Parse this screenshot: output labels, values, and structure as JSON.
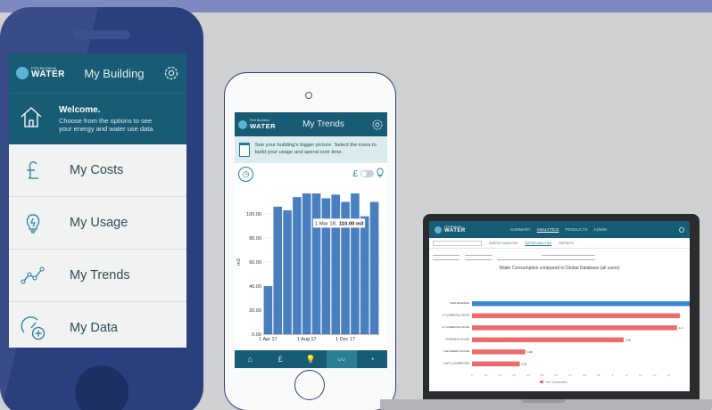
{
  "phone_left": {
    "brand_small": "First Business",
    "brand_big": "WATER",
    "title": "My Building",
    "welcome_title": "Welcome.",
    "welcome_text": "Choose from the options to see your energy and water use data.",
    "menu": [
      {
        "label": "My Costs",
        "icon": "pound-icon"
      },
      {
        "label": "My Usage",
        "icon": "lightbulb-icon"
      },
      {
        "label": "My Trends",
        "icon": "trend-line-icon"
      },
      {
        "label": "My Data",
        "icon": "data-gauge-icon"
      }
    ]
  },
  "phone_middle": {
    "brand_small": "First Business",
    "brand_big": "WATER",
    "title": "My Trends",
    "info_text": "See your building's bigger picture. Select the icons to build your usage and spend over time.",
    "currency_symbol": "£",
    "nav": [
      {
        "icon": "home-icon",
        "glyph": "⌂"
      },
      {
        "icon": "pound-icon",
        "glyph": "£"
      },
      {
        "icon": "lightbulb-icon",
        "glyph": "💡"
      },
      {
        "icon": "trend-line-icon",
        "glyph": "〰"
      },
      {
        "icon": "data-gauge-icon",
        "glyph": "◔"
      }
    ]
  },
  "chart_data": {
    "type": "bar",
    "ylabel": "m3",
    "ylim": [
      0,
      120
    ],
    "yticks": [
      "0.00",
      "20.00",
      "40.00",
      "60.00",
      "80.00",
      "100.00"
    ],
    "xticks": [
      "1 Apr 17",
      "1 Aug 17",
      "1 Dec 17"
    ],
    "values": [
      40,
      106,
      103,
      114,
      117,
      117,
      113,
      116,
      110,
      117,
      98,
      110
    ],
    "bar_color": "#4a7fbf",
    "tooltip_date": "1 Mar 18:",
    "tooltip_value": "110.00 m3"
  },
  "laptop": {
    "brand_small": "First Business",
    "brand_big": "WATER",
    "nav_links": [
      "SUMMARY",
      "ANALYTICS",
      "PRODUCTS",
      "ADMIN"
    ],
    "active_link": "ANALYTICS",
    "sub_tabs": [
      "ENERGY ANALYSIS",
      "WATER ANALYSIS",
      "REPORTS"
    ],
    "chart_title": "Water Consumption compared to Global Database (all users)",
    "bar_labels": [
      "THIS BUILDING",
      "17 LIVERPOOL ROAD",
      "17 LIVERPOOL ROAD",
      "RYMANDS HOUSE",
      "THE GREEN HOUSE",
      "UNIT 12 HARPFORD"
    ],
    "bar_values": [
      1.55,
      1.48,
      1.46,
      1.08,
      0.38,
      0.34
    ],
    "value_labels": [
      "",
      "",
      "1.4",
      "1.08",
      "0.38",
      "0.34"
    ],
    "xticks": [
      "0",
      "0.1",
      "0.2",
      "0.3",
      "0.4",
      "0.5",
      "0.6",
      "0.7",
      "0.8",
      "0.9",
      "1",
      "1.1",
      "1.2",
      "1.3",
      "1.4"
    ],
    "colors": {
      "this": "#3b87d6",
      "others": "#ef6b6b"
    },
    "legend": "Your Consumption"
  }
}
